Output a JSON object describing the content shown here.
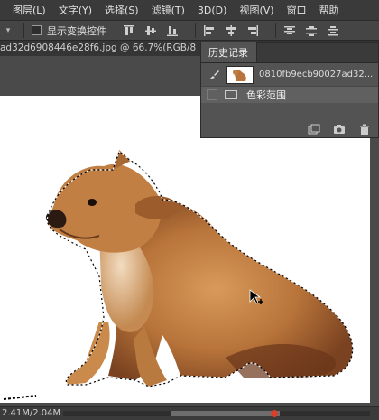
{
  "menubar": {
    "items": [
      "图层(L)",
      "文字(Y)",
      "选择(S)",
      "滤镜(T)",
      "3D(D)",
      "视图(V)",
      "窗口",
      "帮助"
    ]
  },
  "options": {
    "show_transform_label": "显示变换控件",
    "show_transform_checked": false
  },
  "document": {
    "tab_title": "ad32d6908446e28f6.jpg @ 66.7%(RGB/8"
  },
  "history_panel": {
    "tab_label": "历史记录",
    "snapshot_name": "0810fb9ecb90027ad32...",
    "states": [
      {
        "label": "色彩范围"
      }
    ]
  },
  "status": {
    "doc_size": "2.41M/2.04M"
  },
  "colors": {
    "accent_scroll_marker": "#d9402b",
    "fur_primary": "#b8743a"
  },
  "icons": {
    "history_brush": "history-brush-icon",
    "new_snapshot": "new-snapshot-icon",
    "camera": "camera-icon",
    "trash": "trash-icon",
    "cursor": "arrow-cursor-icon"
  }
}
